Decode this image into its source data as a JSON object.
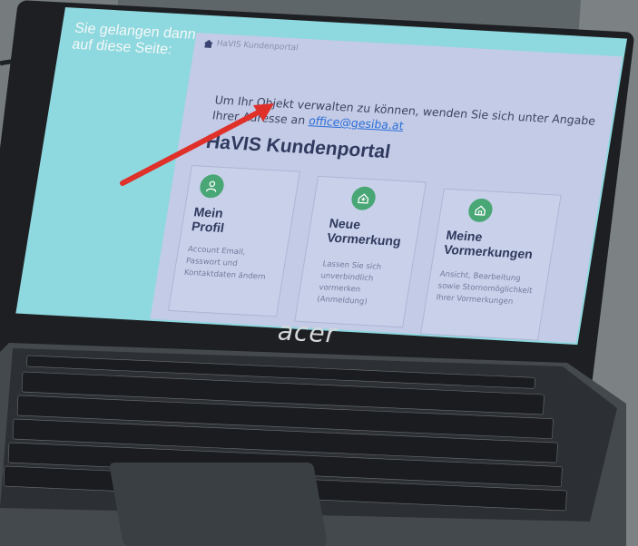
{
  "screen": {
    "hint_text": "Sie gelangen dann auf diese Seite:",
    "breadcrumb": "HaVIS Kundenportal",
    "notice_text": "Um Ihr Objekt verwalten zu können, wenden Sie sich unter Angabe Ihrer Adresse an",
    "notice_email": "office@gesiba.at",
    "portal_title": "HaVIS Kundenportal",
    "cards": [
      {
        "title": "Mein Profil",
        "description": "Account Email, Passwort und Kontaktdaten ändern",
        "icon": "user-icon"
      },
      {
        "title": "Neue Vormerkung",
        "description": "Lassen Sie sich unverbindlich vormerken (Anmeldung)",
        "icon": "house-plus-icon"
      },
      {
        "title": "Meine Vormerkungen",
        "description": "Ansicht, Bearbeitung sowie Stornomöglichkeit Ihrer Vormerkungen",
        "icon": "house-icon"
      }
    ]
  },
  "laptop": {
    "brand": "acer"
  },
  "colors": {
    "screen_bg": "#8ed8df",
    "panel_bg": "#c4cbe6",
    "accent_green": "#49a675",
    "arrow_red": "#e0302a",
    "link_blue": "#2b6fd8"
  }
}
